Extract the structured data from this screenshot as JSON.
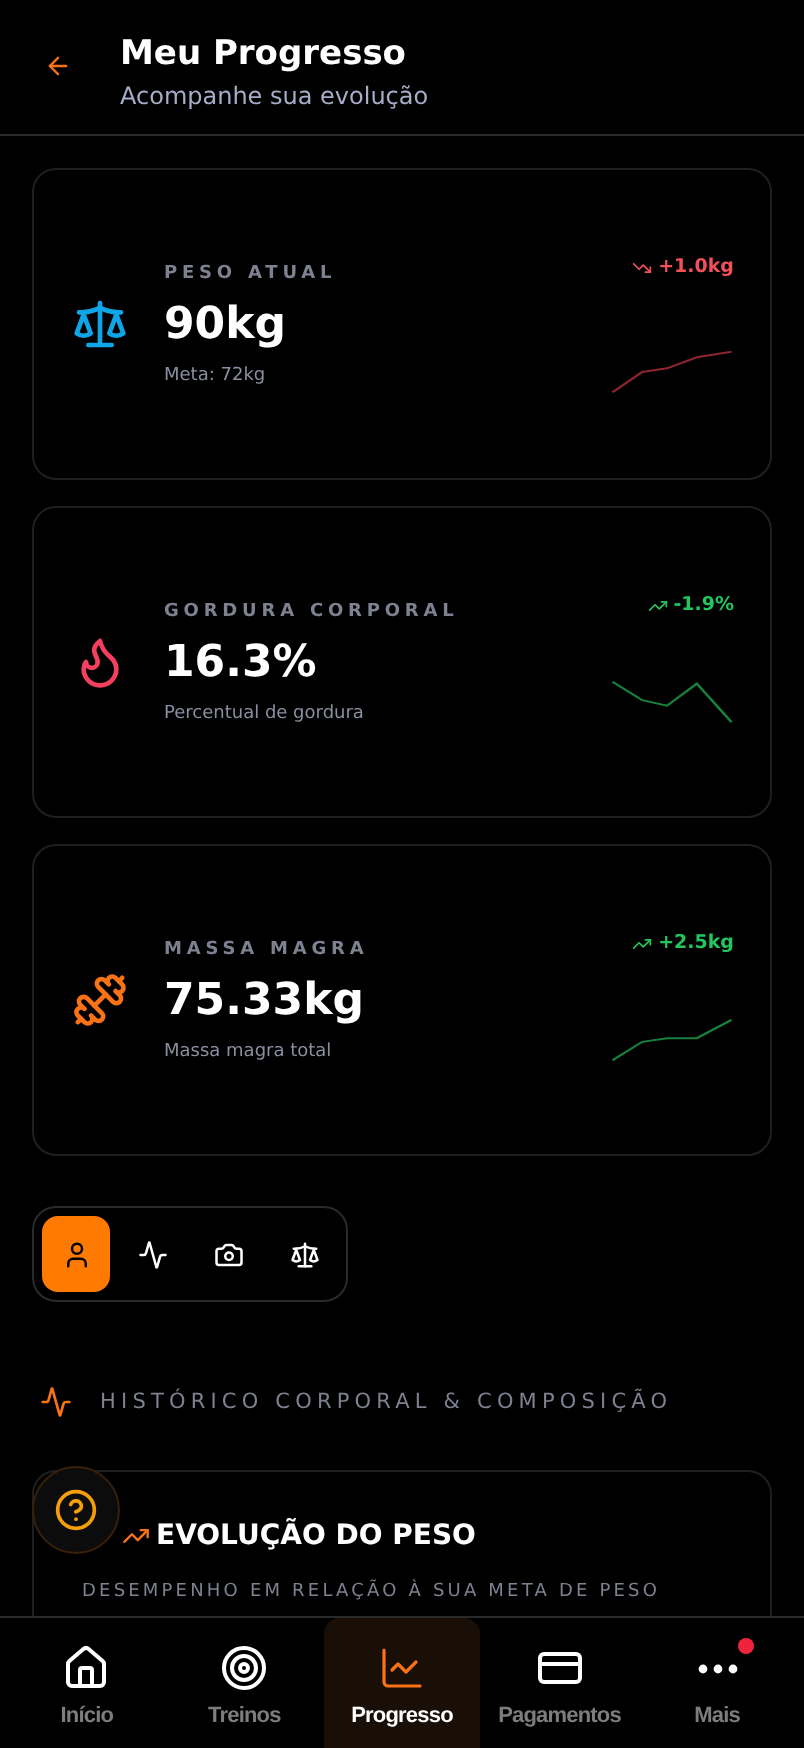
{
  "header": {
    "title": "Meu Progresso",
    "subtitle": "Acompanhe sua evolução"
  },
  "metrics": [
    {
      "label": "PESO ATUAL",
      "value": "90kg",
      "note": "Meta: 72kg",
      "change": "+1.0kg",
      "kind": "falling",
      "color": "#f0505a"
    },
    {
      "label": "GORDURA CORPORAL",
      "value": "16.3%",
      "note": "Percentual de gordura",
      "change": "-1.9%",
      "kind": "rising",
      "color": "#22c55e"
    },
    {
      "label": "MASSA MAGRA",
      "value": "75.33kg",
      "note": "Massa magra total",
      "change": "+2.5kg",
      "kind": "rising",
      "color": "#22c55e"
    }
  ],
  "view_tabs": [
    {
      "selected": true
    },
    {
      "selected": false
    },
    {
      "selected": false
    },
    {
      "selected": false
    }
  ],
  "section": {
    "title": "HISTÓRICO CORPORAL & COMPOSIÇÃO"
  },
  "chart_card": {
    "title": "EVOLUÇÃO DO PESO",
    "subtitle": "DESEMPENHO EM RELAÇÃO À SUA META DE PESO"
  },
  "nav": [
    {
      "label": "Início",
      "selected": false,
      "badge": false
    },
    {
      "label": "Treinos",
      "selected": false,
      "badge": false
    },
    {
      "label": "Progresso",
      "selected": true,
      "badge": false
    },
    {
      "label": "Pagamentos",
      "selected": false,
      "badge": false
    },
    {
      "label": "Mais",
      "selected": false,
      "badge": true
    }
  ]
}
